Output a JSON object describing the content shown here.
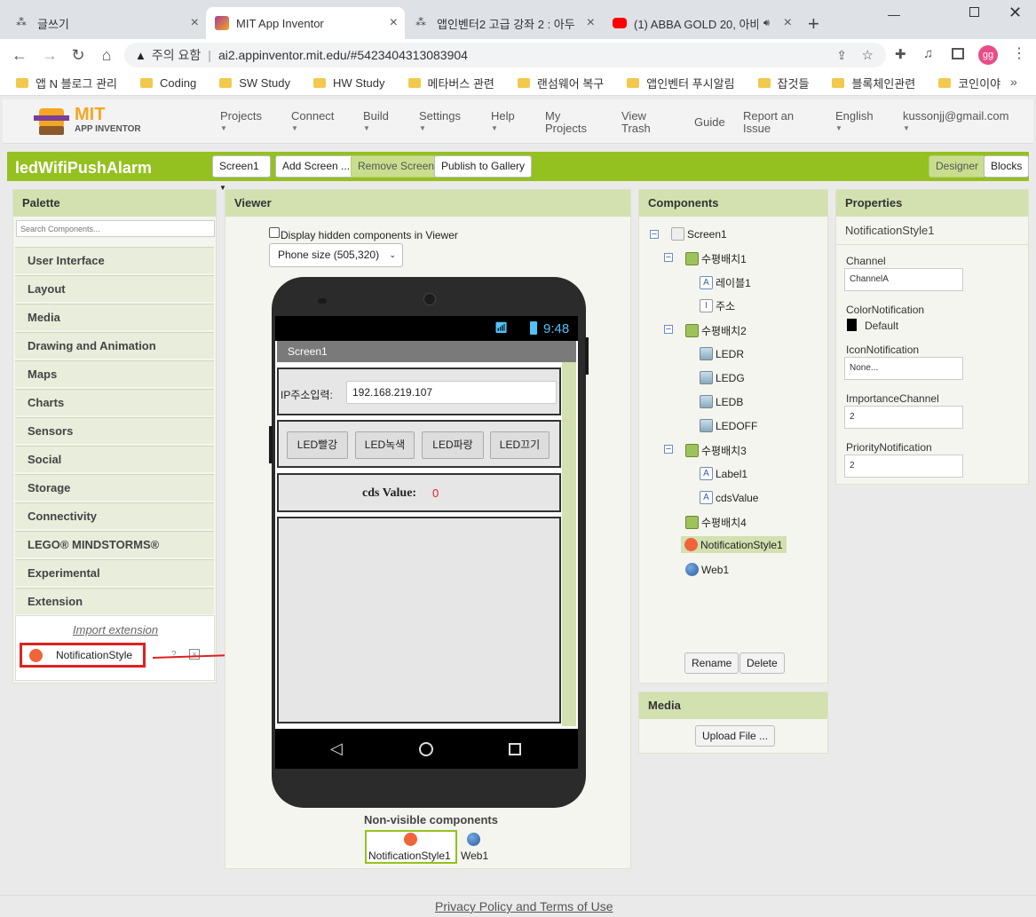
{
  "browser": {
    "tabs": [
      {
        "title": "글쓰기"
      },
      {
        "title": "MIT App Inventor"
      },
      {
        "title": "앱인벤터2 고급 강좌 2 : 아두"
      },
      {
        "title": "(1) ABBA GOLD 20, 아바"
      }
    ],
    "security_label": "주의 요함",
    "url": "ai2.appinventor.mit.edu/#5423404313083904",
    "bookmarks": [
      "앱 N 블로그 관리",
      "Coding",
      "SW Study",
      "HW Study",
      "메타버스 관련",
      "랜섬웨어 복구",
      "앱인벤터 푸시알림",
      "잡것들",
      "블록체인관련",
      "코인이야"
    ],
    "profile_initials": "gg"
  },
  "app": {
    "logo_top": "MIT",
    "logo_bottom": "APP INVENTOR",
    "menu": [
      {
        "label": "Projects"
      },
      {
        "label": "Connect"
      },
      {
        "label": "Build"
      },
      {
        "label": "Settings"
      },
      {
        "label": "Help"
      },
      {
        "label": "My Projects"
      },
      {
        "label": "View Trash"
      },
      {
        "label": "Guide"
      },
      {
        "label": "Report an Issue"
      },
      {
        "label": "English"
      },
      {
        "label": "kussonjj@gmail.com"
      }
    ],
    "project_name": "ledWifiPushAlarm",
    "toolbar": {
      "screen": "Screen1",
      "add_screen": "Add Screen ...",
      "remove_screen": "Remove Screen",
      "publish": "Publish to Gallery",
      "designer": "Designer",
      "blocks": "Blocks"
    }
  },
  "palette": {
    "title": "Palette",
    "search_placeholder": "Search Components...",
    "categories": [
      "User Interface",
      "Layout",
      "Media",
      "Drawing and Animation",
      "Maps",
      "Charts",
      "Sensors",
      "Social",
      "Storage",
      "Connectivity",
      "LEGO® MINDSTORMS®",
      "Experimental",
      "Extension"
    ],
    "import_extension": "Import extension",
    "extension_item": "NotificationStyle"
  },
  "viewer": {
    "title": "Viewer",
    "hidden_checkbox_label": "Display hidden components in Viewer",
    "phone_size": "Phone size (505,320)",
    "clock": "9:48",
    "screen_title": "Screen1",
    "ip_label": "IP주소입력:",
    "ip_value": "192.168.219.107",
    "buttons": [
      "LED빨강",
      "LED녹색",
      "LED파랑",
      "LED끄기"
    ],
    "cds_label": "cds Value:",
    "cds_value": "0",
    "nonvisible_title": "Non-visible components",
    "nonvisible": [
      "NotificationStyle1",
      "Web1"
    ]
  },
  "components": {
    "title": "Components",
    "tree": [
      {
        "label": "Screen1"
      },
      {
        "label": "수평배치1"
      },
      {
        "label": "레이블1"
      },
      {
        "label": "주소"
      },
      {
        "label": "수평배치2"
      },
      {
        "label": "LEDR"
      },
      {
        "label": "LEDG"
      },
      {
        "label": "LEDB"
      },
      {
        "label": "LEDOFF"
      },
      {
        "label": "수평배치3"
      },
      {
        "label": "Label1"
      },
      {
        "label": "cdsValue"
      },
      {
        "label": "수평배치4"
      },
      {
        "label": "NotificationStyle1"
      },
      {
        "label": "Web1"
      }
    ],
    "rename": "Rename",
    "delete": "Delete"
  },
  "media": {
    "title": "Media",
    "upload": "Upload File ..."
  },
  "properties": {
    "title": "Properties",
    "component": "NotificationStyle1",
    "fields": [
      {
        "label": "Channel",
        "value": "ChannelA"
      },
      {
        "label": "ColorNotification",
        "value": "Default"
      },
      {
        "label": "IconNotification",
        "value": "None..."
      },
      {
        "label": "ImportanceChannel",
        "value": "2"
      },
      {
        "label": "PriorityNotification",
        "value": "2"
      }
    ]
  },
  "footer": {
    "privacy": "Privacy Policy and Terms of Use"
  },
  "colors": {
    "accent_green": "#94c11f",
    "panel_header": "#d3e0b0",
    "highlight_red": "#e02020"
  }
}
